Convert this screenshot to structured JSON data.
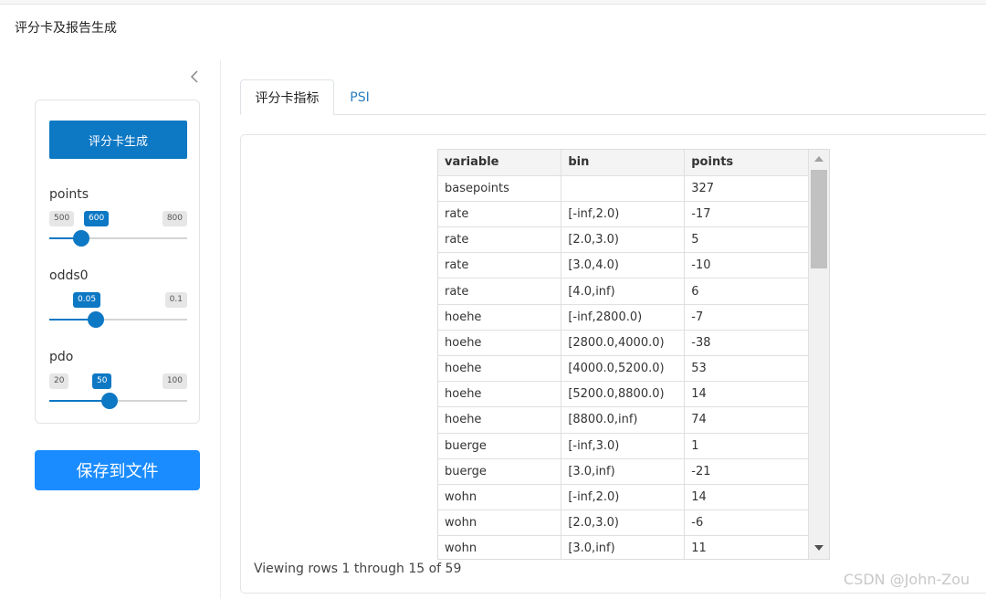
{
  "app": {
    "title": "评分卡及报告生成"
  },
  "sidebar": {
    "collapse_icon": "chevron-left-icon",
    "generate_button": "评分卡生成",
    "sliders": [
      {
        "label": "points",
        "min": "500",
        "value": "600",
        "max": "800",
        "fraction": 0.17
      },
      {
        "label": "odds0",
        "value": "0.05",
        "max": "0.1",
        "fraction": 0.28
      },
      {
        "label": "pdo",
        "min": "20",
        "value": "50",
        "max": "100",
        "fraction": 0.38
      }
    ],
    "save_button": "保存到文件"
  },
  "tabs": [
    {
      "label": "评分卡指标",
      "active": true
    },
    {
      "label": "PSI",
      "active": false
    }
  ],
  "table": {
    "columns": [
      "variable",
      "bin",
      "points"
    ],
    "rows": [
      [
        "basepoints",
        "",
        "327"
      ],
      [
        "rate",
        "[-inf,2.0)",
        "-17"
      ],
      [
        "rate",
        "[2.0,3.0)",
        "5"
      ],
      [
        "rate",
        "[3.0,4.0)",
        "-10"
      ],
      [
        "rate",
        "[4.0,inf)",
        "6"
      ],
      [
        "hoehe",
        "[-inf,2800.0)",
        "-7"
      ],
      [
        "hoehe",
        "[2800.0,4000.0)",
        "-38"
      ],
      [
        "hoehe",
        "[4000.0,5200.0)",
        "53"
      ],
      [
        "hoehe",
        "[5200.0,8800.0)",
        "14"
      ],
      [
        "hoehe",
        "[8800.0,inf)",
        "74"
      ],
      [
        "buerge",
        "[-inf,3.0)",
        "1"
      ],
      [
        "buerge",
        "[3.0,inf)",
        "-21"
      ],
      [
        "wohn",
        "[-inf,2.0)",
        "14"
      ],
      [
        "wohn",
        "[2.0,3.0)",
        "-6"
      ],
      [
        "wohn",
        "[3.0,inf)",
        "11"
      ]
    ],
    "footer": "Viewing rows 1 through 15 of 59"
  },
  "watermark": "CSDN @John-Zou",
  "colors": {
    "primary": "#0d78c4",
    "save": "#1a8cff",
    "tab_link": "#2a7ec1"
  }
}
